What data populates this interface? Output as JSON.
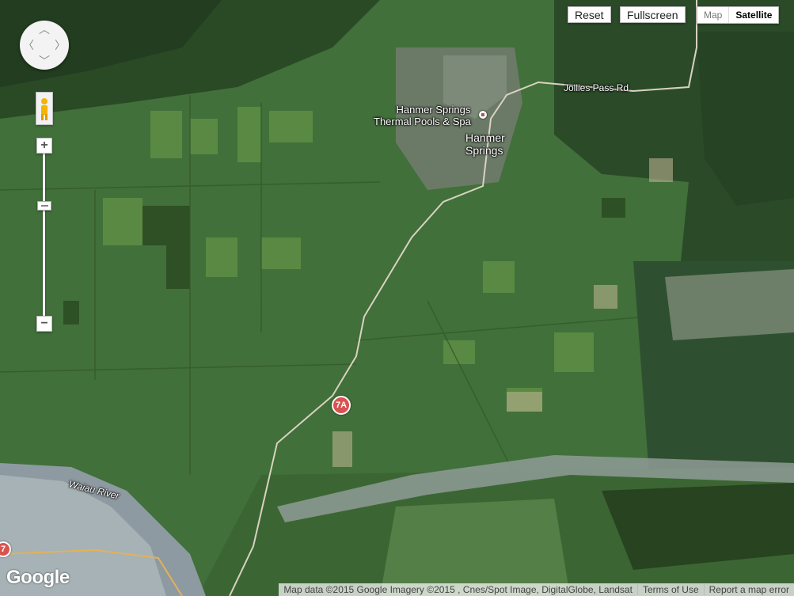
{
  "controls": {
    "reset_label": "Reset",
    "fullscreen_label": "Fullscreen",
    "maptype": {
      "map_label": "Map",
      "satellite_label": "Satellite",
      "selected": "Satellite"
    },
    "pan_icon": "pan-arrows-icon",
    "streetview_icon": "pegman-icon",
    "zoom_in_label": "+",
    "zoom_out_label": "−"
  },
  "places": {
    "poi_line1": "Hanmer Springs",
    "poi_line2": "Thermal Pools & Spa",
    "town_line1": "Hanmer",
    "town_line2": "Springs",
    "road": "Jollies Pass Rd",
    "river": "Waiau River",
    "shield_7a": "7A",
    "shield_7": "7"
  },
  "branding": {
    "logo": "Google"
  },
  "footer": {
    "attribution": "Map data ©2015 Google Imagery ©2015 , Cnes/Spot Image, DigitalGlobe, Landsat",
    "terms": "Terms of Use",
    "report": "Report a map error"
  },
  "colors": {
    "grass": "#3f6a30",
    "river_gravel": "#9aa6a8",
    "shield": "#d9534f"
  }
}
